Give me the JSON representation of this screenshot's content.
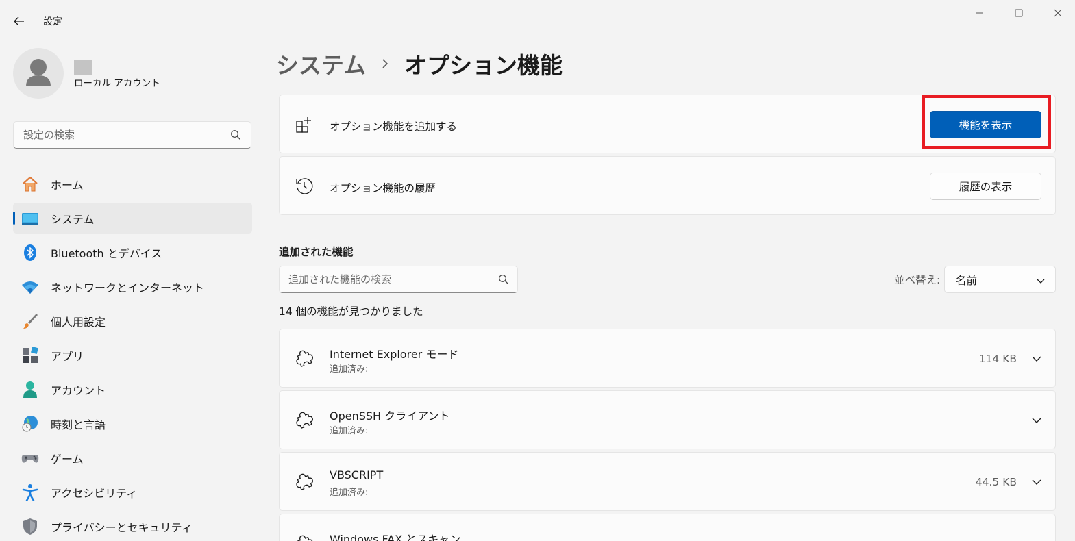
{
  "window": {
    "app_title": "設定",
    "controls": [
      "minimize",
      "maximize",
      "close"
    ]
  },
  "user": {
    "account_type": "ローカル アカウント"
  },
  "sidebar": {
    "search_placeholder": "設定の検索",
    "items": [
      {
        "label": "ホーム",
        "icon": "home-icon"
      },
      {
        "label": "システム",
        "icon": "system-icon",
        "active": true
      },
      {
        "label": "Bluetooth とデバイス",
        "icon": "bluetooth-icon"
      },
      {
        "label": "ネットワークとインターネット",
        "icon": "wifi-icon"
      },
      {
        "label": "個人用設定",
        "icon": "brush-icon"
      },
      {
        "label": "アプリ",
        "icon": "apps-icon"
      },
      {
        "label": "アカウント",
        "icon": "account-icon"
      },
      {
        "label": "時刻と言語",
        "icon": "time-language-icon"
      },
      {
        "label": "ゲーム",
        "icon": "gamepad-icon"
      },
      {
        "label": "アクセシビリティ",
        "icon": "accessibility-icon"
      },
      {
        "label": "プライバシーとセキュリティ",
        "icon": "shield-icon"
      }
    ]
  },
  "breadcrumb": {
    "parent": "システム",
    "current": "オプション機能"
  },
  "add_feature_card": {
    "label": "オプション機能を追加する",
    "button": "機能を表示"
  },
  "history_card": {
    "label": "オプション機能の履歴",
    "button": "履歴の表示"
  },
  "added_features": {
    "title": "追加された機能",
    "search_placeholder": "追加された機能の検索",
    "sort_label": "並べ替え:",
    "sort_value": "名前",
    "count_text": "14 個の機能が見つかりました",
    "items": [
      {
        "name": "Internet Explorer モード",
        "status": "追加済み:",
        "size": "114 KB"
      },
      {
        "name": "OpenSSH クライアント",
        "status": "追加済み:",
        "size": ""
      },
      {
        "name": "VBSCRIPT",
        "status": "追加済み:",
        "size": "44.5 KB"
      },
      {
        "name": "Windows FAX とスキャン",
        "status": "",
        "size": ""
      }
    ]
  },
  "colors": {
    "accent": "#005fb8",
    "highlight": "#e81c23",
    "background": "#f3f3f3",
    "card": "#fbfbfb"
  }
}
